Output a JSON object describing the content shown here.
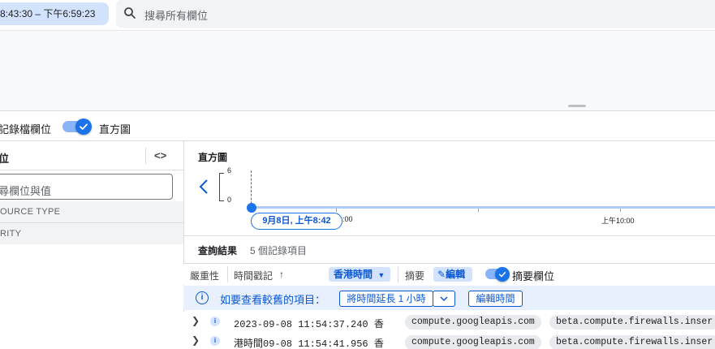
{
  "topbar": {
    "time_range": "8:43:30 – 下午6:59:23",
    "search_placeholder": "搜尋所有欄位"
  },
  "toolbar": {
    "log_fields_label": "記錄檔欄位",
    "histogram_label": "直方圖"
  },
  "left_panel": {
    "title": "位",
    "code_icon": "<>",
    "search_placeholder": "尋欄位與值",
    "rows": [
      "OURCE TYPE",
      "RITY"
    ]
  },
  "histogram": {
    "title": "直方圖",
    "y_ticks": [
      "6",
      "0"
    ],
    "x_ticks": [
      ":00",
      "上午10:00"
    ],
    "date_chip": "9月8日, 上午8:42"
  },
  "results": {
    "title": "查詢結果",
    "count": "5 個記錄項目",
    "columns": {
      "severity": "嚴重性",
      "timestamp": "時間戳記",
      "sort_arrow": "↑",
      "timezone": "香港時間",
      "summary": "摘要",
      "edit": "編輯",
      "summary_fields": "摘要欄位"
    },
    "banner": {
      "text": "如要查看較舊的項目：",
      "extend_btn": "將時間延長 1 小時",
      "edit_btn": "編輯時間"
    },
    "rows": [
      {
        "timestamp": "2023-09-08 11:54:37.240 香",
        "tag1": "compute.googleapis.com",
        "tag2": "beta.compute.firewalls.inser"
      },
      {
        "timestamp": "港時間09-08 11:54:41.956 香",
        "tag1": "compute.googleapis.com",
        "tag2": "beta.compute.firewalls.inser"
      }
    ]
  },
  "colors": {
    "accent": "#1a73e8",
    "chip_bg": "#d3e3fd",
    "link": "#0b57d0"
  }
}
